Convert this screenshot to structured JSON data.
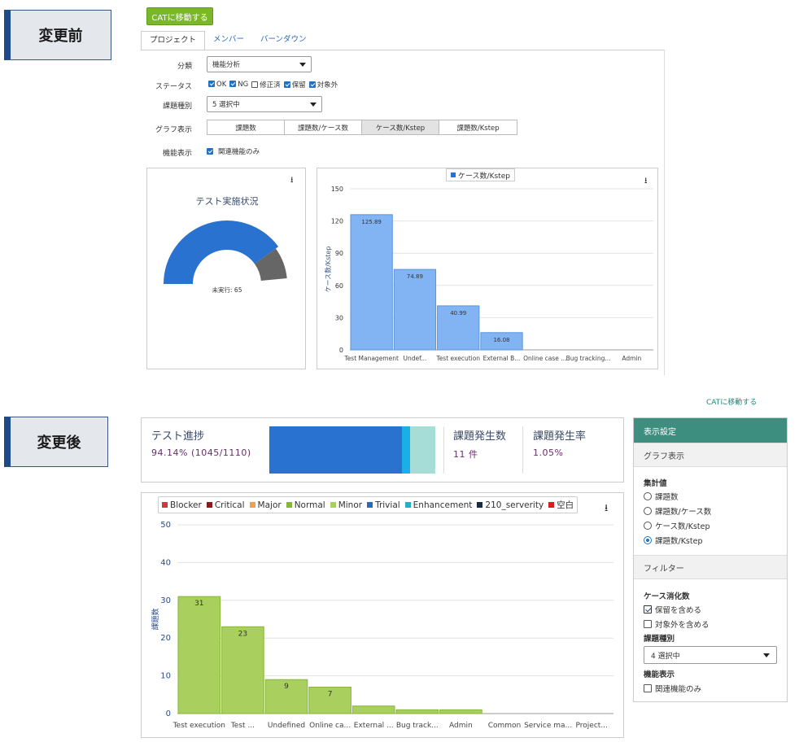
{
  "labels": {
    "before": "変更前",
    "after": "変更後"
  },
  "before": {
    "cat_button": "CATに移動する",
    "tabs": [
      "プロジェクト",
      "メンバー",
      "バーンダウン"
    ],
    "form": {
      "bunrui_label": "分類",
      "bunrui_value": "機能分析",
      "status_label": "ステータス",
      "status_options": [
        {
          "label": "OK",
          "checked": true
        },
        {
          "label": "NG",
          "checked": true
        },
        {
          "label": "修正済",
          "checked": false
        },
        {
          "label": "保留",
          "checked": true
        },
        {
          "label": "対象外",
          "checked": true
        }
      ],
      "kadai_label": "課題種別",
      "kadai_value": "5 選択中",
      "graph_label": "グラフ表示",
      "graph_options": [
        "課題数",
        "課題数/ケース数",
        "ケース数/Kstep",
        "課題数/Kstep"
      ],
      "graph_selected": 2,
      "kinou_label": "機能表示",
      "kinou_option": "関連機能のみ"
    },
    "gauge": {
      "title": "テスト実施状況",
      "label": "未実行: 65",
      "executed_fraction": 0.94,
      "colors": [
        "#2a72cf",
        "#666666"
      ]
    },
    "chart_data": {
      "type": "bar",
      "legend": "ケース数/Kstep",
      "ylabel": "ケース数/Kstep",
      "ylim": [
        0,
        150
      ],
      "yticks": [
        0,
        30,
        60,
        90,
        120,
        150
      ],
      "categories": [
        "Test Management",
        "Undef...",
        "Test execution",
        "External B...",
        "Online case ...",
        "Bug tracking...",
        "Admin"
      ],
      "values": [
        125.89,
        74.89,
        40.99,
        16.08,
        0,
        0,
        0
      ],
      "value_labels": [
        "125.89",
        "74.89",
        "40.99",
        "16.08",
        "",
        "",
        ""
      ],
      "color": "#82b4f3"
    }
  },
  "after": {
    "cat_link": "CATに移動する",
    "summary": {
      "progress_title": "テスト進捗",
      "progress_value": "94.14% (1045/1110)",
      "progress_segments": [
        {
          "fraction": 0.8,
          "color": "#2a72cf"
        },
        {
          "fraction": 0.05,
          "color": "#1ab0e6"
        },
        {
          "fraction": 0.15,
          "color": "#a6ddd6"
        }
      ],
      "issue_count_title": "課題発生数",
      "issue_count_value": "11 件",
      "issue_rate_title": "課題発生率",
      "issue_rate_value": "1.05%"
    },
    "legend": [
      {
        "name": "Blocker",
        "color": "#d03a3a"
      },
      {
        "name": "Critical",
        "color": "#8b1a1a"
      },
      {
        "name": "Major",
        "color": "#f0a050"
      },
      {
        "name": "Normal",
        "color": "#86b53a"
      },
      {
        "name": "Minor",
        "color": "#a9cf5e"
      },
      {
        "name": "Trivial",
        "color": "#2a6bbf"
      },
      {
        "name": "Enhancement",
        "color": "#20b0c8"
      },
      {
        "name": "210_serverity",
        "color": "#1a2a40"
      },
      {
        "name": "空白",
        "color": "#d82020"
      }
    ],
    "chart_data": {
      "type": "bar",
      "ylabel": "課題数",
      "ylim": [
        0,
        50
      ],
      "yticks": [
        0,
        10,
        20,
        30,
        40,
        50
      ],
      "categories": [
        "Test execution",
        "Test ...",
        "Undefined",
        "Online ca...",
        "External ...",
        "Bug track...",
        "Admin",
        "Common",
        "Service ma...",
        "Project..."
      ],
      "values": [
        31,
        23,
        9,
        7,
        2,
        1,
        1,
        0,
        0,
        0
      ],
      "value_labels": [
        "31",
        "23",
        "9",
        "7",
        "",
        "",
        "",
        "",
        "",
        ""
      ],
      "color": "#a9cf5e"
    },
    "side": {
      "title": "表示設定",
      "graph_section": "グラフ表示",
      "agg_label": "集計値",
      "agg_options": [
        "課題数",
        "課題数/ケース数",
        "ケース数/Kstep",
        "課題数/Kstep"
      ],
      "agg_selected": 3,
      "filter_section": "フィルター",
      "case_label": "ケース消化数",
      "case_options": [
        {
          "label": "保留を含める",
          "checked": true
        },
        {
          "label": "対象外を含める",
          "checked": false
        }
      ],
      "kadai_label": "課題種別",
      "kadai_value": "4 選択中",
      "kinou_label": "機能表示",
      "kinou_option": {
        "label": "関連機能のみ",
        "checked": false
      }
    }
  }
}
